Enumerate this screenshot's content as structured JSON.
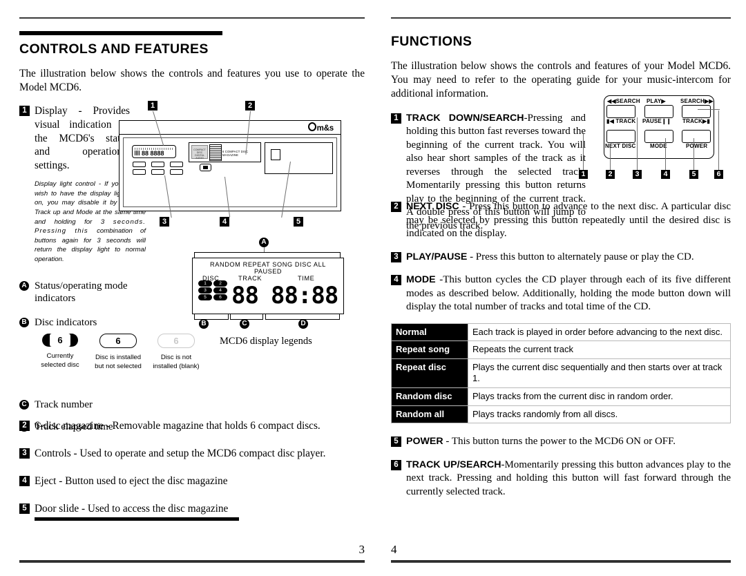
{
  "document": {
    "left_page_number": "3",
    "right_page_number": "4"
  },
  "left_column": {
    "section_title": "CONTROLS AND FEATURES",
    "intro": "The illustration below shows the controls and features you use to operate the Model MCD6.",
    "item1": {
      "badge": "1",
      "text": "Display - Provides visual indication of the MCD6's status and operational settings.",
      "note_part1": "Display light control - If you do not wish to have the display light come on, you may disable it by pressing Track up and Mode at the same time and holding for 3 ",
      "note_spaced": "seconds. Pressing this ",
      "note_part2": "combination of buttons again for 3 seconds will return the display light to normal operation."
    },
    "legends": [
      {
        "mark": "A",
        "label": "Status/operating mode indicators"
      },
      {
        "mark": "B",
        "label": "Disc indicators"
      },
      {
        "mark": "C",
        "label": "Track number"
      },
      {
        "mark": "D",
        "label": "Track elapsed time"
      }
    ],
    "disc_swatches": [
      {
        "number": "6",
        "caption": "Currently selected disc",
        "state": "selected"
      },
      {
        "number": "6",
        "caption": "Disc is installed but not selected",
        "state": "installed"
      },
      {
        "number": "6",
        "caption": "Disc is not installed (blank)",
        "state": "blank"
      }
    ],
    "items": [
      {
        "badge": "2",
        "text": "6-disc magazine - Removable magazine that holds 6 compact discs."
      },
      {
        "badge": "3",
        "text": "Controls - Used to operate and setup the MCD6 compact disc player."
      },
      {
        "badge": "4",
        "text": "Eject - Button used to eject the disc magazine"
      },
      {
        "badge": "5",
        "text": "Door slide - Used to access the disc magazine"
      }
    ]
  },
  "device_illustration": {
    "brand_logo": "m&s",
    "lcd_digits": "88 8888",
    "magazine_label": "6 COMPACT DISC MAGAZINE",
    "magazine_disc_text": "COMPACT DISC DIGITAL AUDIO",
    "callouts": [
      "1",
      "2",
      "3",
      "4",
      "5"
    ]
  },
  "display_legend": {
    "caption": "MCD6 display legends",
    "status_line": "RANDOM  REPEAT  SONG  DISC  ALL",
    "paused": "PAUSED",
    "disc_label": "DISC",
    "track_label": "TRACK",
    "time_label": "TIME",
    "disc_numbers": [
      "1",
      "2",
      "3",
      "4",
      "5",
      "6"
    ],
    "track_digits": "88",
    "time_digits": "88:88",
    "marks": {
      "top": "A",
      "left": "B",
      "middle": "C",
      "right": "D"
    }
  },
  "right_column": {
    "section_title": "FUNCTIONS",
    "intro": "The illustration below shows the controls and features of your Model MCD6. You may need to refer to the operating guide for your music-intercom for additional information.",
    "items": [
      {
        "badge": "1",
        "bold": "TRACK DOWN/SEARCH",
        "text": "-Pressing and holding this button fast reverses toward the beginning of the current track. You will also hear short samples of the track as it reverses through the selected track. Momentarily pressing this button  returns play to the beginning of the current track. A double press of this button will jump to the previous track."
      },
      {
        "badge": "2",
        "bold": "NEXT DISC",
        "text": " - Press this button to advance to the next disc. A particular disc may be selected by pressing this button repeatedly until the desired disc is indicated on the display."
      },
      {
        "badge": "3",
        "bold": "PLAY/PAUSE",
        "text": " - Press this button to alternately pause or play the CD."
      },
      {
        "badge": "4",
        "bold": "MODE",
        "text": " -This button cycles the CD player through each of its five different modes as described below. Additionally, holding the mode button down will display the total number of tracks and total time of the CD."
      },
      {
        "badge": "5",
        "bold": "POWER",
        "text": " - This button turns the power to the MCD6 ON or OFF."
      },
      {
        "badge": "6",
        "bold": "TRACK UP/SEARCH",
        "text": "-Momentarily pressing this button advances play to the next track. Pressing and holding this button will fast forward through the currently selected track."
      }
    ],
    "modes_table": {
      "rows": [
        {
          "mode": "Normal",
          "description": "Each track is played in order before advancing to the next disc."
        },
        {
          "mode": "Repeat song",
          "description": "Repeats the current track"
        },
        {
          "mode": "Repeat disc",
          "description": "Plays the current disc sequentially and then starts over at track 1."
        },
        {
          "mode": "Random disc",
          "description": "Plays tracks from the current disc in random order."
        },
        {
          "mode": "Random all",
          "description": "Plays tracks randomly from all discs."
        }
      ]
    }
  },
  "control_panel": {
    "labels": {
      "search_back": "SEARCH",
      "track_back": "TRACK",
      "play": "PLAY",
      "pause": "PAUSE",
      "search_fwd": "SEARCH",
      "track_fwd": "TRACK",
      "next_disc": "NEXT DISC",
      "mode": "MODE",
      "power": "POWER"
    },
    "callouts": [
      "1",
      "2",
      "3",
      "4",
      "5",
      "6"
    ]
  }
}
